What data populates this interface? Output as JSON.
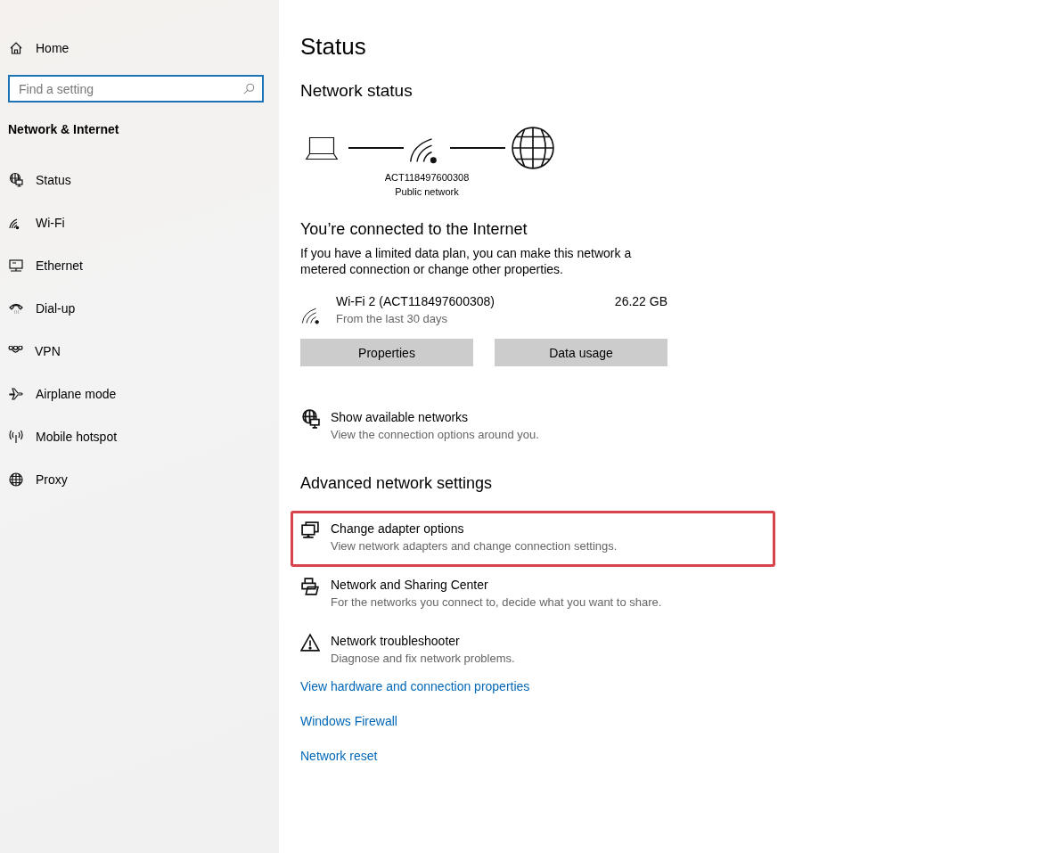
{
  "sidebar": {
    "home": {
      "label": "Home"
    },
    "search": {
      "placeholder": "Find a setting"
    },
    "section_title": "Network & Internet",
    "items": [
      {
        "kind": "status",
        "label": "Status"
      },
      {
        "kind": "wifi",
        "label": "Wi-Fi"
      },
      {
        "kind": "ethernet",
        "label": "Ethernet"
      },
      {
        "kind": "dialup",
        "label": "Dial-up"
      },
      {
        "kind": "vpn",
        "label": "VPN"
      },
      {
        "kind": "airplane",
        "label": "Airplane mode"
      },
      {
        "kind": "hotspot",
        "label": "Mobile hotspot"
      },
      {
        "kind": "proxy",
        "label": "Proxy"
      }
    ]
  },
  "main": {
    "title": "Status",
    "network_status": {
      "heading": "Network status",
      "network_name": "ACT118497600308",
      "network_type": "Public network"
    },
    "connection": {
      "heading": "You’re connected to the Internet",
      "description": "If you have a limited data plan, you can make this network a metered connection or change other properties.",
      "adapter": {
        "name": "Wi-Fi 2 (ACT118497600308)",
        "period": "From the last 30 days",
        "usage": "26.22 GB"
      },
      "buttons": [
        "Properties",
        "Data usage"
      ]
    },
    "show_networks": {
      "kind": "globe",
      "title": "Show available networks",
      "description": "View the connection options around you."
    },
    "advanced": {
      "heading": "Advanced network settings",
      "items": [
        {
          "kind": "adapter",
          "title": "Change adapter options",
          "description": "View network adapters and change connection settings.",
          "highlighted": true
        },
        {
          "kind": "sharing",
          "title": "Network and Sharing Center",
          "description": "For the networks you connect to, decide what you want to share.",
          "highlighted": false
        },
        {
          "kind": "warning",
          "title": "Network troubleshooter",
          "description": "Diagnose and fix network problems.",
          "highlighted": false
        }
      ]
    },
    "links": [
      "View hardware and connection properties",
      "Windows Firewall",
      "Network reset"
    ]
  }
}
